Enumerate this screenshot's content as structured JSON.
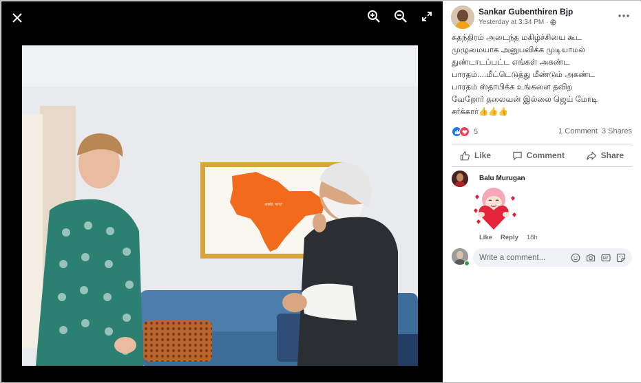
{
  "viewer": {
    "tools": {
      "close": "close-icon",
      "zoom_in": "zoom-in-icon",
      "zoom_out": "zoom-out-icon",
      "fullscreen": "fullscreen-icon"
    },
    "photo_map_label": "अखंड भारत"
  },
  "post": {
    "author": "Sankar Gubenthiren Bjp",
    "timestamp": "Yesterday at 3:34 PM ·",
    "privacy_icon": "globe-icon",
    "text": "சுதந்திரம் அடைந்த மகிழ்ச்சியை கூட\nமுழுமையாக அனுபவிக்க முடியாமல்\nதுண்டாடப்பட்ட எங்கள் அகண்ட\nபாரதம்....மீட்டெடுத்து மீண்டும் அகண்ட\nபாரதம் ஸ்தாபிக்க உங்களை தவிற\nவேறோர் தலைவன் இல்லை ஜெய் மோடி\nசர்க்கார்👍👍👍",
    "reaction_count": "5",
    "comments": "1 Comment",
    "shares": "3 Shares",
    "actions": {
      "like": "Like",
      "comment": "Comment",
      "share": "Share"
    }
  },
  "comment": {
    "name": "Balu Murugan",
    "like": "Like",
    "reply": "Reply",
    "age": "18h"
  },
  "composer": {
    "placeholder": "Write a comment..."
  },
  "colors": {
    "accent": "#1877f2",
    "love": "#f33e58",
    "online": "#31a24c",
    "map": "#f26a1b"
  }
}
